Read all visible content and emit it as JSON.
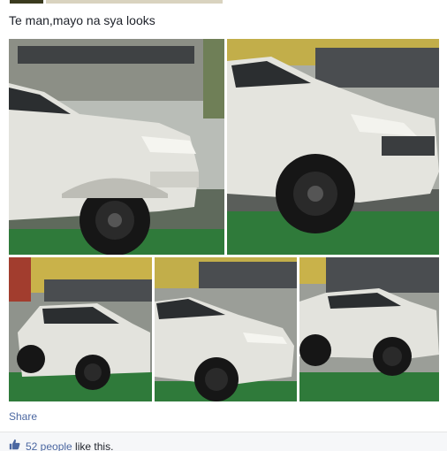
{
  "post": {
    "caption": "Te man,mayo na sya looks",
    "share_label": "Share",
    "likes_count_text": "52 people",
    "likes_suffix": " like this."
  },
  "photos": [
    {
      "subject": "white pickup truck front-left view"
    },
    {
      "subject": "white pickup truck front view"
    },
    {
      "subject": "white pickup truck side view"
    },
    {
      "subject": "white pickup truck front three-quarter view"
    },
    {
      "subject": "white pickup truck right side view"
    }
  ],
  "colors": {
    "link": "#4b67a1",
    "truck_body": "#d9d9d4",
    "tire": "#161616",
    "floor_green": "#2f7a3a",
    "wall_yellow": "#c9b24a"
  },
  "icons": {
    "like": "thumbs-up-icon"
  }
}
